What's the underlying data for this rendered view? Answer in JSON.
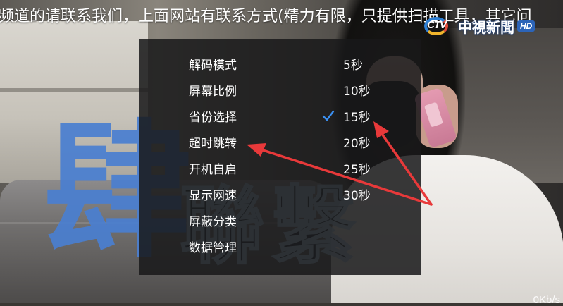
{
  "ticker": {
    "text": "频道的请联系我们，上面网站有联系方式(精力有限，只提供扫描工具，其它问"
  },
  "channel_logo": {
    "mark_text": "CTV",
    "name": "中視新聞",
    "badge": "HD"
  },
  "overlay_text": {
    "blue_char": "肆",
    "dark_chars": [
      "聯",
      "繫"
    ]
  },
  "settings_menu": {
    "items": [
      {
        "label": "解码模式"
      },
      {
        "label": "屏幕比例"
      },
      {
        "label": "省份选择"
      },
      {
        "label": "超时跳转"
      },
      {
        "label": "开机自启"
      },
      {
        "label": "显示网速"
      },
      {
        "label": "屏蔽分类"
      },
      {
        "label": "数据管理"
      }
    ],
    "timeout_options": [
      {
        "label": "5秒",
        "selected": false
      },
      {
        "label": "10秒",
        "selected": false
      },
      {
        "label": "15秒",
        "selected": true
      },
      {
        "label": "20秒",
        "selected": false
      },
      {
        "label": "25秒",
        "selected": false
      },
      {
        "label": "30秒",
        "selected": false
      }
    ],
    "check_color": "#3b8ff0"
  },
  "annotation": {
    "arrow_color": "#e8393a"
  },
  "network_speed": {
    "text": "0Kb/s"
  }
}
